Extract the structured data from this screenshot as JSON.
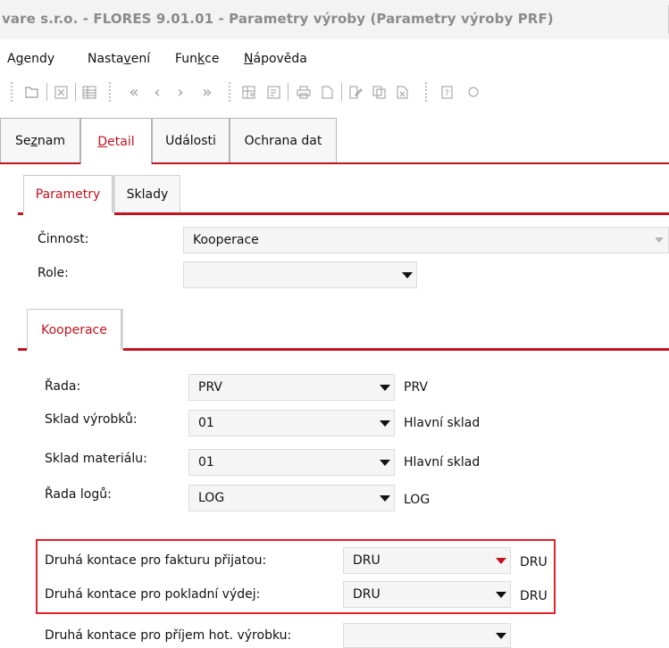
{
  "window": {
    "title": "vare  s.r.o. - FLORES 9.01.01 - Parametry výroby  (Parametry výroby PRF)"
  },
  "menu": [
    {
      "pre": "A",
      "u": "g",
      "post": "endy"
    },
    {
      "pre": "Nasta",
      "u": "v",
      "post": "ení"
    },
    {
      "pre": "Fun",
      "u": "k",
      "post": "ce"
    },
    {
      "pre": "",
      "u": "N",
      "post": "ápověda"
    }
  ],
  "toolbar": {
    "icons": [
      "open-icon",
      "close-icon",
      "columns-icon",
      "first-record-icon",
      "previous-record-icon",
      "next-record-icon",
      "last-record-icon",
      "table-view-icon",
      "form-view-icon",
      "print-icon",
      "new-document-icon",
      "edit-icon",
      "copy-icon",
      "delete-icon",
      "help-icon",
      "search-icon"
    ]
  },
  "main_tabs": [
    {
      "pre": "Se",
      "u": "z",
      "post": "nam",
      "active": false
    },
    {
      "pre": "",
      "u": "D",
      "post": "etail",
      "active": true
    },
    {
      "pre": "Události",
      "u": "",
      "post": "",
      "active": false
    },
    {
      "pre": "Ochrana dat",
      "u": "",
      "post": "",
      "active": false
    }
  ],
  "sub_tabs": {
    "parametry": "Parametry",
    "sklady": "Sklady"
  },
  "params": {
    "cinnost_label": "Činnost:",
    "cinnost_value": "Kooperace",
    "role_label": "Role:",
    "role_value": ""
  },
  "section_tab": "Kooperace",
  "fields": [
    {
      "label": "Řada:",
      "value": "PRV",
      "desc": "PRV"
    },
    {
      "label": "Sklad výrobků:",
      "value": "01",
      "desc": "Hlavní sklad"
    },
    {
      "label": "Sklad materiálu:",
      "value": "01",
      "desc": "Hlavní sklad"
    },
    {
      "label": "Řada logů:",
      "value": "LOG",
      "desc": "LOG"
    }
  ],
  "contacts": [
    {
      "label": "Druhá kontace pro fakturu přijatou:",
      "value": "DRU",
      "desc": "DRU"
    },
    {
      "label": "Druhá kontace pro pokladní výdej:",
      "value": "DRU",
      "desc": "DRU"
    },
    {
      "label": "Druhá kontace pro příjem hot. výrobku:",
      "value": "",
      "desc": ""
    }
  ],
  "colors": {
    "accent": "#c1121f",
    "highlight_box": "#e0212e"
  }
}
